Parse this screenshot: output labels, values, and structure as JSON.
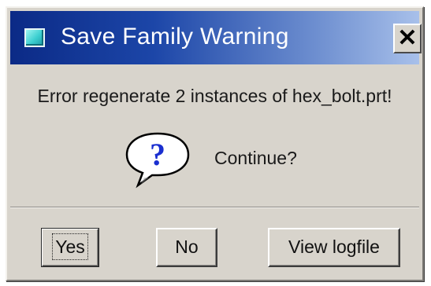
{
  "window": {
    "title": "Save Family Warning",
    "icon": "app-window-icon",
    "close_label": "✕"
  },
  "body": {
    "message": "Error regenerate 2 instances of hex_bolt.prt!",
    "prompt": "Continue?",
    "icon": "question-bubble-icon"
  },
  "buttons": {
    "yes": "Yes",
    "no": "No",
    "view_logfile": "View logfile"
  },
  "colors": {
    "title_gradient_start": "#0b2a86",
    "title_gradient_end": "#a8c0ea",
    "dialog_bg": "#d8d4cc",
    "question_mark": "#1a2fd0"
  }
}
